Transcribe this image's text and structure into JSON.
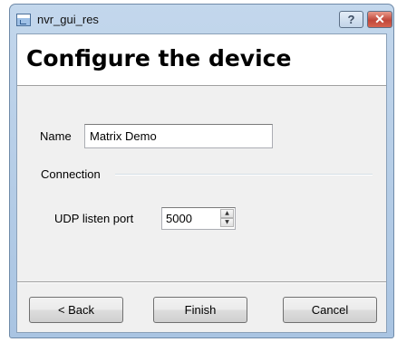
{
  "window": {
    "title": "nvr_gui_res",
    "help_label": "?",
    "close_label": "✕"
  },
  "page": {
    "title": "Configure the device"
  },
  "form": {
    "name_label": "Name",
    "name_value": "Matrix Demo",
    "connection_label": "Connection",
    "port_label": "UDP listen port",
    "port_value": "5000"
  },
  "buttons": {
    "back": "< Back",
    "finish": "Finish",
    "cancel": "Cancel"
  }
}
